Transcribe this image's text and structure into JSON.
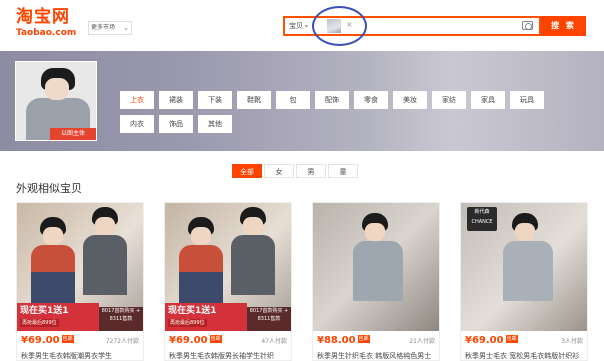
{
  "header": {
    "logo_cn": "淘宝网",
    "logo_en": "Taobao.com",
    "market_label": "更多市场",
    "search_type": "宝贝",
    "search_button": "搜 索"
  },
  "band": {
    "hero_tag": "以图主体",
    "tags_row1": [
      "上衣",
      "裙装",
      "下装",
      "鞋靴",
      "包",
      "配饰",
      "零食",
      "美妆",
      "家纺",
      "家具",
      "玩具"
    ],
    "tags_row2": [
      "内衣",
      "饰品",
      "其他"
    ],
    "active_tag": "上衣"
  },
  "filters": {
    "tabs": [
      "全部",
      "女",
      "男",
      "童"
    ],
    "active": "全部"
  },
  "section_title": "外观相似宝贝",
  "products": [
    {
      "promo_main": "现在买1送1",
      "promo_sub": "再抢最后899位",
      "promo_side": "8017首款购买 + 8311售款",
      "badge": "",
      "price": "¥69.00",
      "sold": "7272人付款",
      "caption": "秋季男生毛衣韩版潮男衣学生"
    },
    {
      "promo_main": "现在买1送1",
      "promo_sub": "再抢最后899位",
      "promo_side": "8017首款购买 + 8311售款",
      "badge": "",
      "price": "¥69.00",
      "sold": "47人付款",
      "caption": "秋季男生毛衣韩版男长袖学生针织"
    },
    {
      "promo_main": "",
      "promo_sub": "",
      "promo_side": "",
      "badge": "",
      "price": "¥88.00",
      "sold": "21人付款",
      "caption": "秋季男生针织毛衣 韩版风格纯色男士"
    },
    {
      "promo_main": "",
      "promo_sub": "",
      "promo_side": "",
      "badge": "新代森 CHANCE",
      "price": "¥69.00",
      "sold": "3人付款",
      "caption": "秋季男士毛衣 宽松男毛衣韩版针织衫"
    }
  ],
  "colors": {
    "accent": "#ff4400",
    "promo_red": "#d4323a"
  }
}
